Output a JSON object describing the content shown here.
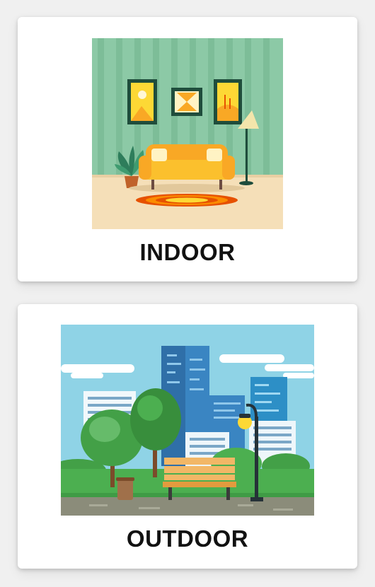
{
  "cards": [
    {
      "label": "INDOOR",
      "illustration": "living-room-illustration"
    },
    {
      "label": "OUTDOOR",
      "illustration": "city-park-illustration"
    }
  ],
  "colors": {
    "background": "#f0f0f0",
    "card": "#ffffff",
    "label_text": "#111111",
    "indoor_wall": "#8cc9a6",
    "indoor_floor": "#f5dfb8",
    "sofa": "#f9a825",
    "outdoor_sky": "#8fd3e6",
    "grass": "#4caf50",
    "bench": "#f2b766"
  }
}
